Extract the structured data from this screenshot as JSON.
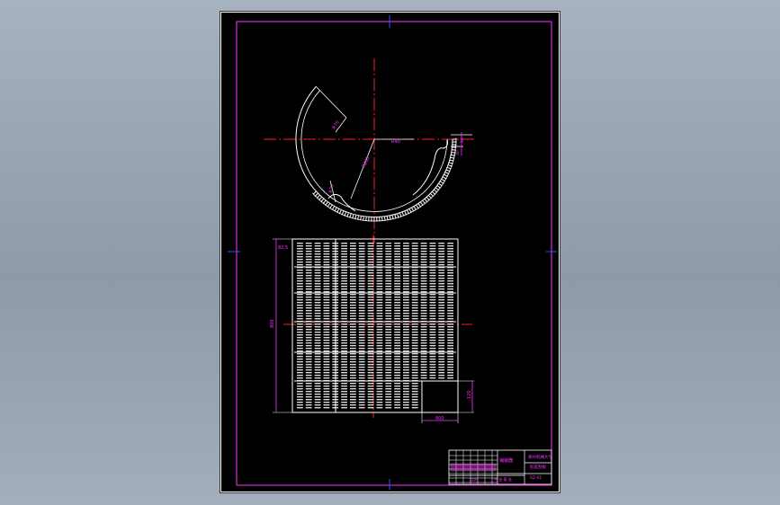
{
  "drawing": {
    "dims": {
      "arc_radius": "R280",
      "arc_small": "R70",
      "arc_center": "R40",
      "height": "800",
      "top_left": "82.5",
      "notch_w": "600",
      "notch_h": "120",
      "right_a": "20",
      "right_b": "30"
    },
    "title_block": {
      "name": "铺装器",
      "company": "郑州机械大学",
      "part": "胶皮刮板",
      "code": "SZ-01",
      "scale": "比例",
      "sheet_no": "共 张 第 张"
    }
  },
  "colors": {
    "background": "#8e9aa9",
    "sheet": "#000000",
    "frame": "#ff33ff",
    "centerline": "#ff2020",
    "linework": "#ffffff",
    "dimension": "#ff33ff",
    "axis_marker": "#3355ff"
  }
}
